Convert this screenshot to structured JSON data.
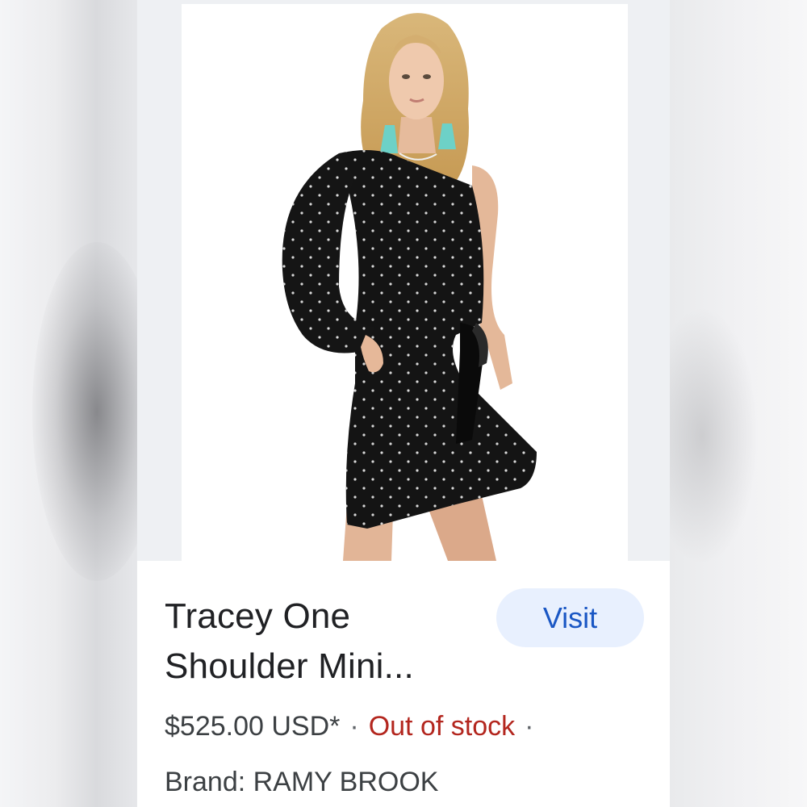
{
  "product": {
    "title_line1": "Tracey One",
    "title_line2": "Shoulder Mini...",
    "price": "$525.00 USD*",
    "separator": "·",
    "stock_status": "Out of stock",
    "brand": "Brand: RAMY BROOK",
    "image_icon": "product-photo"
  },
  "actions": {
    "visit_label": "Visit"
  },
  "colors": {
    "visit_bg": "#e8f0fe",
    "visit_text": "#1a57c4",
    "stock_red": "#b3261e",
    "title_text": "#202124"
  }
}
